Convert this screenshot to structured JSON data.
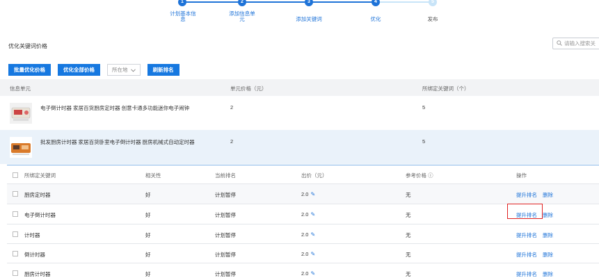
{
  "steps": [
    {
      "num": "1",
      "label": "计划基本信息"
    },
    {
      "num": "2",
      "label": "添加信息单元"
    },
    {
      "num": "3",
      "label": "添加关键词"
    },
    {
      "num": "4",
      "label": "优化"
    },
    {
      "num": "5",
      "label": "发布"
    }
  ],
  "section_title": "优化关键词价格",
  "search": {
    "placeholder": "请输入搜索关"
  },
  "toolbar": {
    "batch_optimize": "批量优化价格",
    "optimize_all": "优化全部价格",
    "location": "所在地",
    "refresh_rank": "刷新排名"
  },
  "units_header": {
    "col1": "信息单元",
    "col2": "单元价格（元）",
    "col3": "所绑定关键词（个）"
  },
  "units": [
    {
      "title": "电子倒计时器 家居百货厨房定时器 创意卡通多功能迷你电子闹钟",
      "price": "2",
      "keywords": "5"
    },
    {
      "title": "批发厨房计时器 家居百货卧室电子倒计时器 厨房机械式自动定时器",
      "price": "2",
      "keywords": "5"
    }
  ],
  "kw_header": {
    "col1": "所绑定关键词",
    "col2": "相关性",
    "col3": "当前排名",
    "col4": "出价（元）",
    "col5": "参考价格 ⓘ",
    "col6": "操作"
  },
  "keywords": [
    {
      "name": "厨房定时器",
      "relevance": "好",
      "rank": "计划暂停",
      "bid": "2.0",
      "ref": "无",
      "action1": "提升排名",
      "action2": "删除"
    },
    {
      "name": "电子倒计时器",
      "relevance": "好",
      "rank": "计划暂停",
      "bid": "2.0",
      "ref": "无",
      "action1": "提升排名",
      "action2": "删除"
    },
    {
      "name": "计时器",
      "relevance": "好",
      "rank": "计划暂停",
      "bid": "2.0",
      "ref": "无",
      "action1": "提升排名",
      "action2": "删除"
    },
    {
      "name": "倒计时器",
      "relevance": "好",
      "rank": "计划暂停",
      "bid": "2.0",
      "ref": "无",
      "action1": "提升排名",
      "action2": "删除"
    },
    {
      "name": "厨房计时器",
      "relevance": "好",
      "rank": "计划暂停",
      "bid": "2.0",
      "ref": "无",
      "action1": "提升排名",
      "action2": "删除"
    }
  ],
  "colors": {
    "accent": "#1678e0",
    "step_inactive": "#c8e4f8",
    "highlight": "#e02020"
  }
}
